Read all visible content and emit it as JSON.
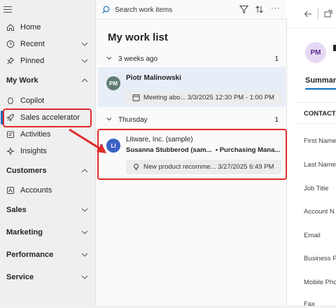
{
  "sidebar": {
    "items": [
      {
        "label": "Home",
        "icon": "home-icon"
      },
      {
        "label": "Recent",
        "icon": "clock-icon"
      },
      {
        "label": "Pinned",
        "icon": "pin-icon"
      }
    ],
    "my_work": {
      "title": "My Work",
      "items": [
        {
          "label": "Copilot",
          "icon": "copilot-icon"
        },
        {
          "label": "Sales accelerator",
          "icon": "rocket-icon"
        },
        {
          "label": "Activities",
          "icon": "activities-icon"
        },
        {
          "label": "Insights",
          "icon": "insights-icon"
        }
      ]
    },
    "customers": {
      "title": "Customers",
      "items": [
        {
          "label": "Accounts",
          "icon": "accounts-icon"
        }
      ]
    },
    "sections": [
      "Sales",
      "Marketing",
      "Performance",
      "Service"
    ]
  },
  "worklist": {
    "search_placeholder": "Search work items",
    "title": "My work list",
    "groups": [
      {
        "label": "3 weeks ago",
        "count": "1",
        "card": {
          "initials": "PM",
          "avatar_color": "#607d73",
          "name": "Piotr Malinowski",
          "activity": "Meeting abo... 3/3/2025 12:30 PM - 1:00 PM"
        }
      },
      {
        "label": "Thursday",
        "count": "1",
        "card": {
          "initials": "LI",
          "avatar_color": "#3a62c4",
          "name": "Litware, Inc. (sample)",
          "subline": "Susanna Stubberod (sam...  • Purchasing Mana...",
          "activity": "New product recomme... 3/27/2025 6:49 PM"
        }
      }
    ]
  },
  "detail": {
    "avatar_initials": "PM",
    "tab": "Summar",
    "section": "CONTACT",
    "fields": [
      "First Name",
      "Last Name",
      "Job Title",
      "Account N",
      "Email",
      "Business P",
      "Mobile Pho",
      "Fax"
    ]
  },
  "colors": {
    "accent": "#0f6cbd",
    "highlight": "#e22a2a",
    "selected_card": "#e8eef8"
  }
}
